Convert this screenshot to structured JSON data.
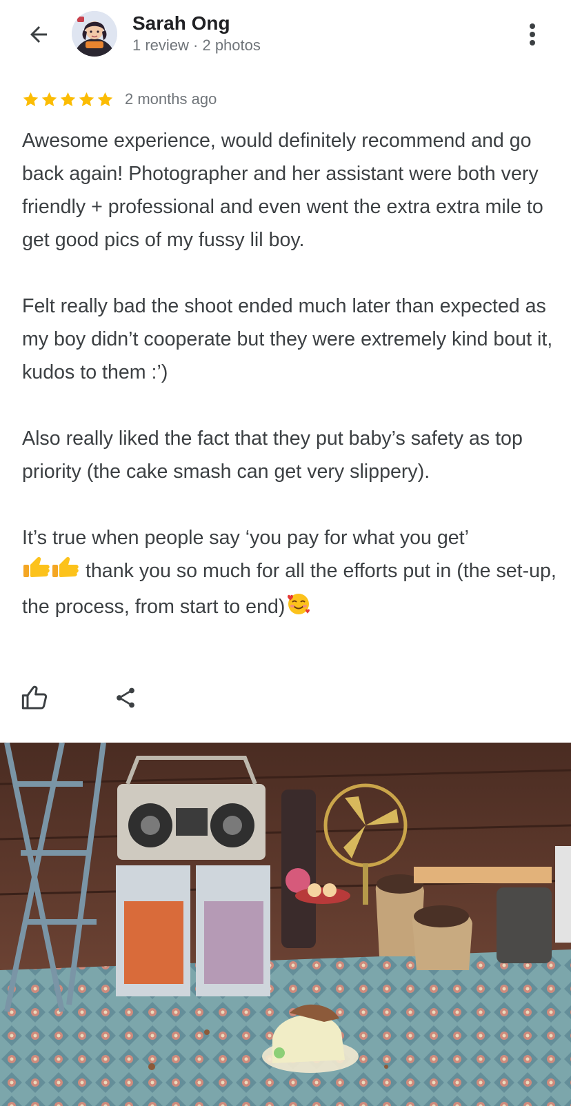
{
  "header": {
    "reviewer_name": "Sarah Ong",
    "reviewer_meta": "1 review · 2 photos",
    "back_icon": "arrow-back-icon",
    "more_icon": "more-vert-icon"
  },
  "review": {
    "rating": 5,
    "rating_max": 5,
    "date": "2 months ago",
    "paragraph_1": "Awesome experience, would definitely recommend and go back again! Photographer and her assistant were both very friendly + professional and even went the extra extra mile to get good pics of my fussy lil boy.",
    "paragraph_2": "Felt really bad the shoot ended much later than expected as my boy didn’t cooperate but they were extremely kind bout it, kudos to them :’)",
    "paragraph_3": "Also really liked the fact that they put baby’s safety as top priority (the cake smash can get very slippery).",
    "paragraph_4_part_1": "It’s true when people say ‘you pay for what you get’",
    "paragraph_4_part_2": " thank you so much for all the efforts put in (the set-up, the process, from start to end)"
  },
  "actions": {
    "like_icon": "thumb-up-icon",
    "share_icon": "share-icon"
  },
  "colors": {
    "star": "#fbbc04",
    "text": "#3c4043",
    "name": "#202124",
    "secondary": "#70757a"
  }
}
